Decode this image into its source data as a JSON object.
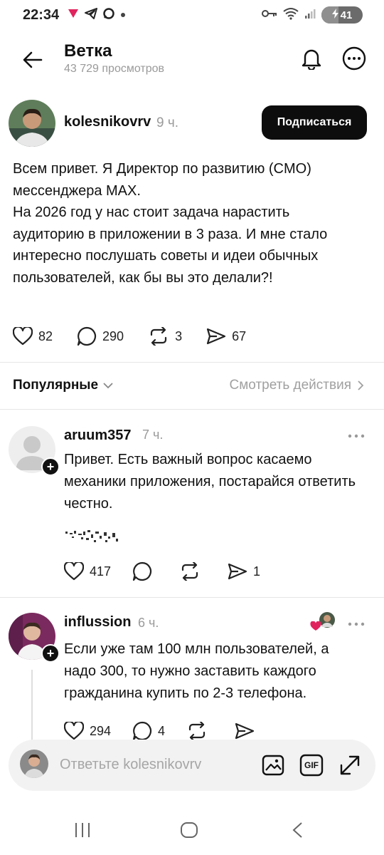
{
  "status_bar": {
    "time": "22:34",
    "notification_icons": [
      "vk-heart-icon",
      "telegram-icon",
      "max-icon",
      "dot-icon"
    ],
    "battery_level": "41",
    "battery_fraction": 0.41
  },
  "header": {
    "title": "Ветка",
    "views": "43 729 просмотров"
  },
  "post": {
    "author": "kolesnikovrv",
    "time": "9 ч.",
    "subscribe_label": "Подписаться",
    "text": "Всем привет. Я Директор по развитию (CMO) мессенджера MAX.\nНа 2026 год у нас стоит задача нарастить аудиторию в приложении в 3 раза. И мне стало интересно послушать советы и идеи обычных пользователей, как бы вы это делали?!",
    "likes": "82",
    "comments": "290",
    "reposts": "3",
    "shares": "67"
  },
  "filter": {
    "popular_label": "Популярные",
    "view_actions_label": "Смотреть действия"
  },
  "comments": [
    {
      "author": "aruum357",
      "time": "7 ч.",
      "text": "Привет. Есть важный вопрос касаемо механики приложения, постарайся ответить честно.",
      "likes": "417",
      "comments": "",
      "reposts": "",
      "shares": "1"
    },
    {
      "author": "influssion",
      "time": "6 ч.",
      "text": "Если уже там 100 млн пользователей, а надо 300, то нужно заставить каждого гражданина купить по 2-3 телефона.",
      "likes": "294",
      "comments": "4",
      "reposts": "",
      "shares": ""
    }
  ],
  "reply_bar": {
    "placeholder": "Ответьте kolesnikovrv",
    "gif_label": "GIF"
  },
  "colors": {
    "primary_text": "#111111",
    "secondary_text": "#9a9a9a",
    "button_dark": "#0d0d0d",
    "divider": "#e6e6e6",
    "reply_bar_bg": "#f2f2f2",
    "like_heart_red": "#e0245e"
  }
}
